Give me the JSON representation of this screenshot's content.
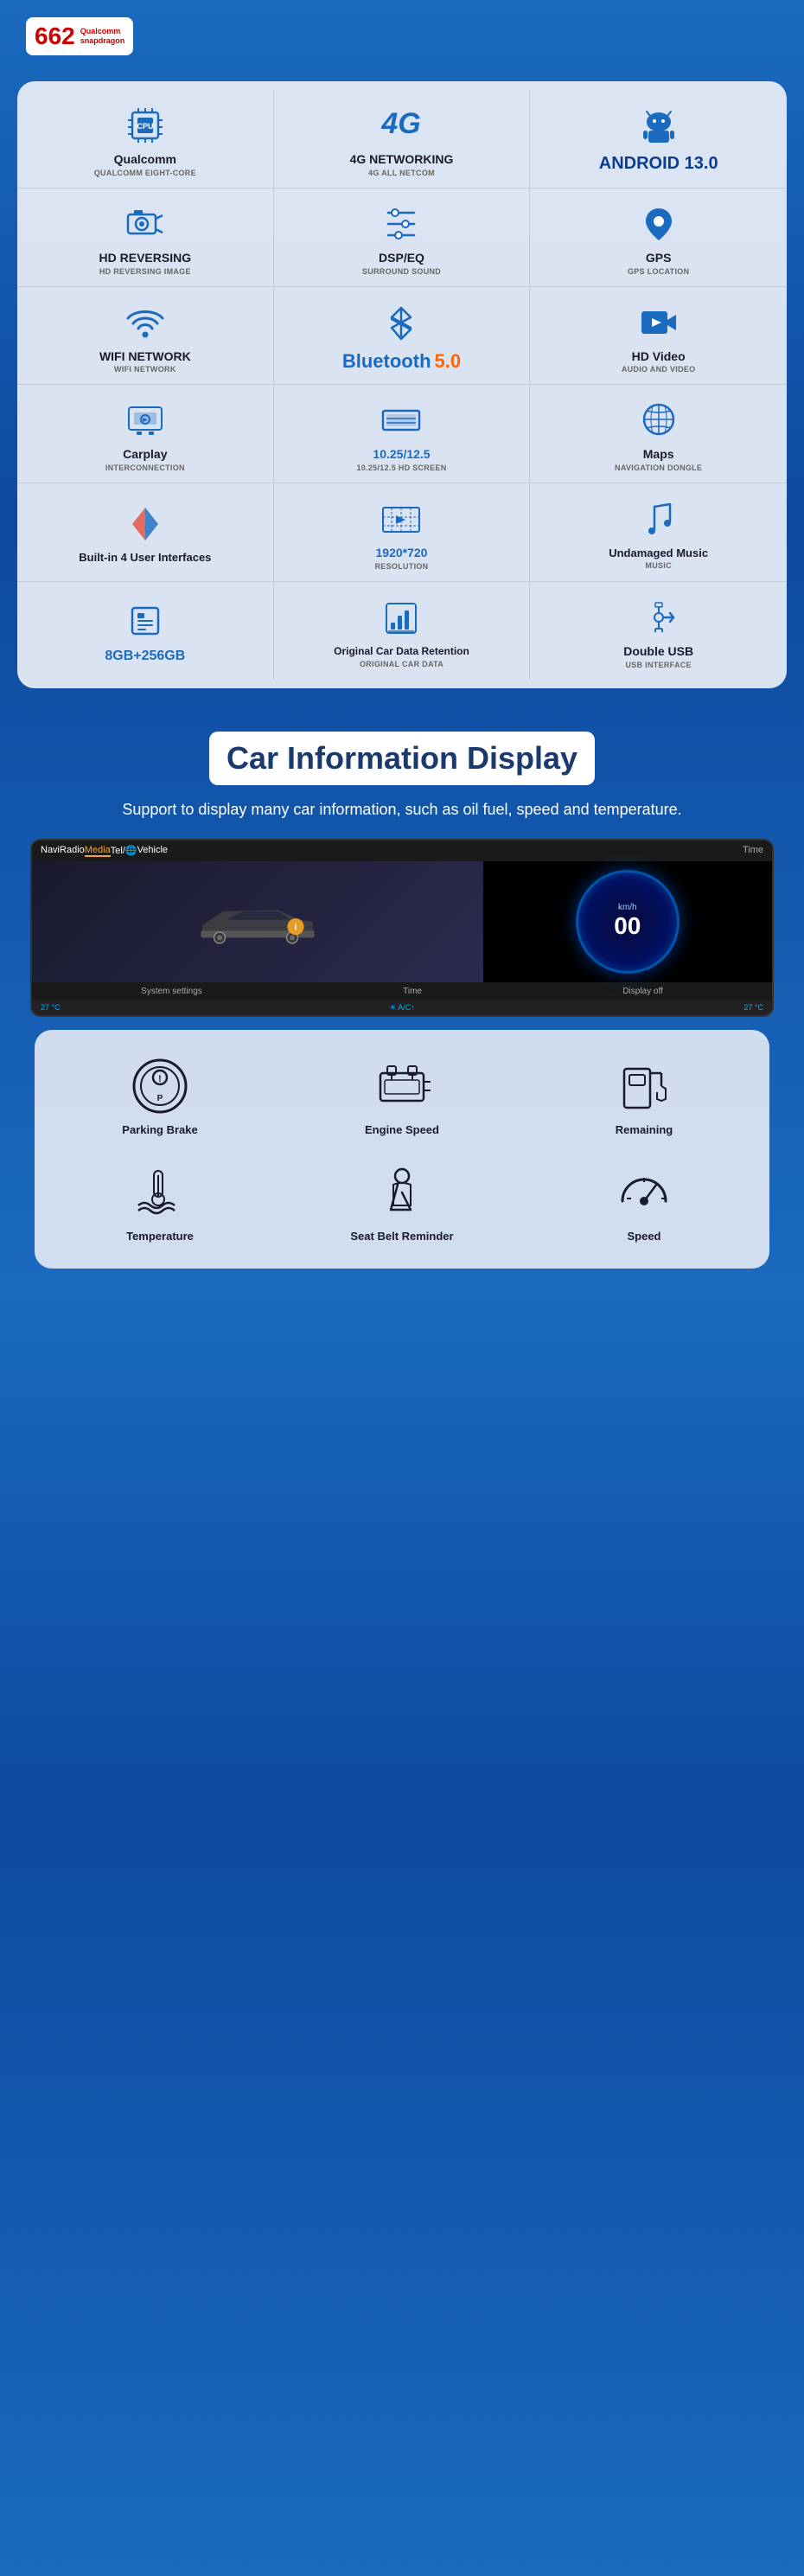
{
  "header": {
    "badge": {
      "number": "662",
      "brand": "Qualcomm",
      "model": "snapdragon"
    }
  },
  "features": [
    {
      "id": "qualcomm",
      "title": "Qualcomm",
      "subtitle": "QUALCOMM EIGHT-CORE",
      "icon": "cpu"
    },
    {
      "id": "4g",
      "title": "4G NETWORKING",
      "subtitle": "4G ALL NETCOM",
      "icon": "4g"
    },
    {
      "id": "android",
      "title": "ANDROID 13.0",
      "subtitle": "",
      "icon": "android"
    },
    {
      "id": "hd-reversing",
      "title": "HD REVERSING",
      "subtitle": "HD REVERSING IMAGE",
      "icon": "camera"
    },
    {
      "id": "dsp",
      "title": "DSP/EQ",
      "subtitle": "SURROUND SOUND",
      "icon": "equalizer"
    },
    {
      "id": "gps",
      "title": "GPS",
      "subtitle": "GPS LOCATION",
      "icon": "gps"
    },
    {
      "id": "wifi",
      "title": "WIFI NETWORK",
      "subtitle": "WIFI NETWORK",
      "icon": "wifi"
    },
    {
      "id": "bluetooth",
      "title": "Bluetooth",
      "version": "5.0",
      "subtitle": "",
      "icon": "bluetooth"
    },
    {
      "id": "hd-video",
      "title": "HD Video",
      "subtitle": "AUDIO AND VIDEO",
      "icon": "video"
    },
    {
      "id": "carplay",
      "title": "Carplay",
      "subtitle": "INTERCONNECTION",
      "icon": "carplay"
    },
    {
      "id": "screen",
      "title": "10.25/12.5",
      "subtitle": "10.25/12.5 HD SCREEN",
      "icon": "screen"
    },
    {
      "id": "maps",
      "title": "Maps",
      "subtitle": "NAVIGATION DONGLE",
      "icon": "maps"
    },
    {
      "id": "interfaces",
      "title": "Built-in 4 User Interfaces",
      "subtitle": "",
      "icon": "interfaces"
    },
    {
      "id": "resolution",
      "title": "1920*720",
      "subtitle": "Resolution",
      "icon": "resolution"
    },
    {
      "id": "music",
      "title": "Undamaged Music",
      "subtitle": "MUSIC",
      "icon": "music"
    },
    {
      "id": "storage",
      "title": "8GB+256GB",
      "subtitle": "",
      "icon": "storage"
    },
    {
      "id": "car-data",
      "title": "Original Car Data Retention",
      "subtitle": "ORIGINAL CAR DATA",
      "icon": "data"
    },
    {
      "id": "usb",
      "title": "Double USB",
      "subtitle": "USB INTERFACE",
      "icon": "usb"
    }
  ],
  "car_info": {
    "title": "Car Information Display",
    "description": "Support to display many car information, such as\noil fuel, speed and temperature.",
    "dashboard": {
      "nav_items": [
        "Navi",
        "Radio",
        "Media",
        "Tel/🌐",
        "Vehicle"
      ],
      "active_nav": "Media",
      "bottom_items": [
        "System settings",
        "Time",
        "Display off"
      ],
      "status": [
        "27 °C",
        "A/C↑",
        "27 °C"
      ],
      "speed_value": "00",
      "speed_unit": "km/h"
    },
    "icons": [
      {
        "id": "parking-brake",
        "label": "Parking Brake"
      },
      {
        "id": "engine-speed",
        "label": "Engine Speed"
      },
      {
        "id": "remaining",
        "label": "Remaining"
      },
      {
        "id": "temperature",
        "label": "Temperature"
      },
      {
        "id": "seat-belt",
        "label": "Seat Belt Reminder"
      },
      {
        "id": "speed",
        "label": "Speed"
      }
    ]
  }
}
